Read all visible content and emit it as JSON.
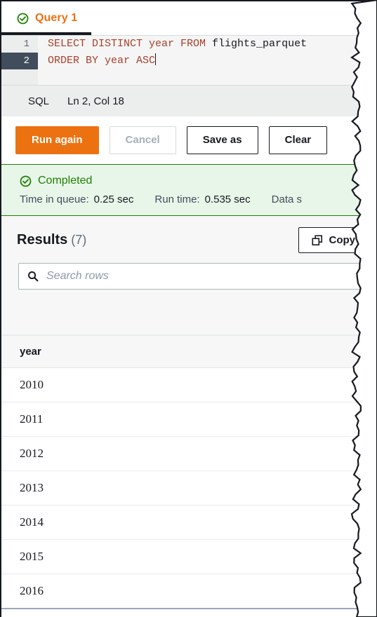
{
  "tabs": [
    {
      "label": "Query 1",
      "icon": "check-circle-icon",
      "status": "completed",
      "active": true
    }
  ],
  "editor": {
    "language": "SQL",
    "cursor": "Ln 2, Col 18",
    "lines": [
      {
        "number": "1",
        "active": false,
        "tokens": [
          {
            "t": "SELECT DISTINCT year FROM ",
            "type": "keyword"
          },
          {
            "t": "flights_parquet",
            "type": "identifier"
          }
        ]
      },
      {
        "number": "2",
        "active": true,
        "tokens": [
          {
            "t": "ORDER BY year ASC",
            "type": "keyword"
          }
        ]
      }
    ]
  },
  "actions": {
    "run_again": "Run again",
    "cancel": "Cancel",
    "save_as": "Save as",
    "clear": "Clear"
  },
  "status": {
    "state": "Completed",
    "icon": "check-circle-icon",
    "metrics": [
      {
        "label": "Time in queue:",
        "value": "0.25 sec"
      },
      {
        "label": "Run time:",
        "value": "0.535 sec"
      },
      {
        "label": "Data s",
        "value": ""
      }
    ]
  },
  "results": {
    "title": "Results",
    "count": "(7)",
    "copy_label": "Copy",
    "copy_icon": "copy-icon",
    "search": {
      "icon": "search-icon",
      "placeholder": "Search rows",
      "value": ""
    },
    "columns": [
      "year"
    ],
    "rows": [
      [
        "2010"
      ],
      [
        "2011"
      ],
      [
        "2012"
      ],
      [
        "2013"
      ],
      [
        "2014"
      ],
      [
        "2015"
      ],
      [
        "2016"
      ]
    ]
  },
  "colors": {
    "accent_orange": "#ec7211",
    "success_green": "#1d8102",
    "alert_bg": "#e8f5e9",
    "dark": "#16191f",
    "gutter_active": "#414d5c"
  }
}
